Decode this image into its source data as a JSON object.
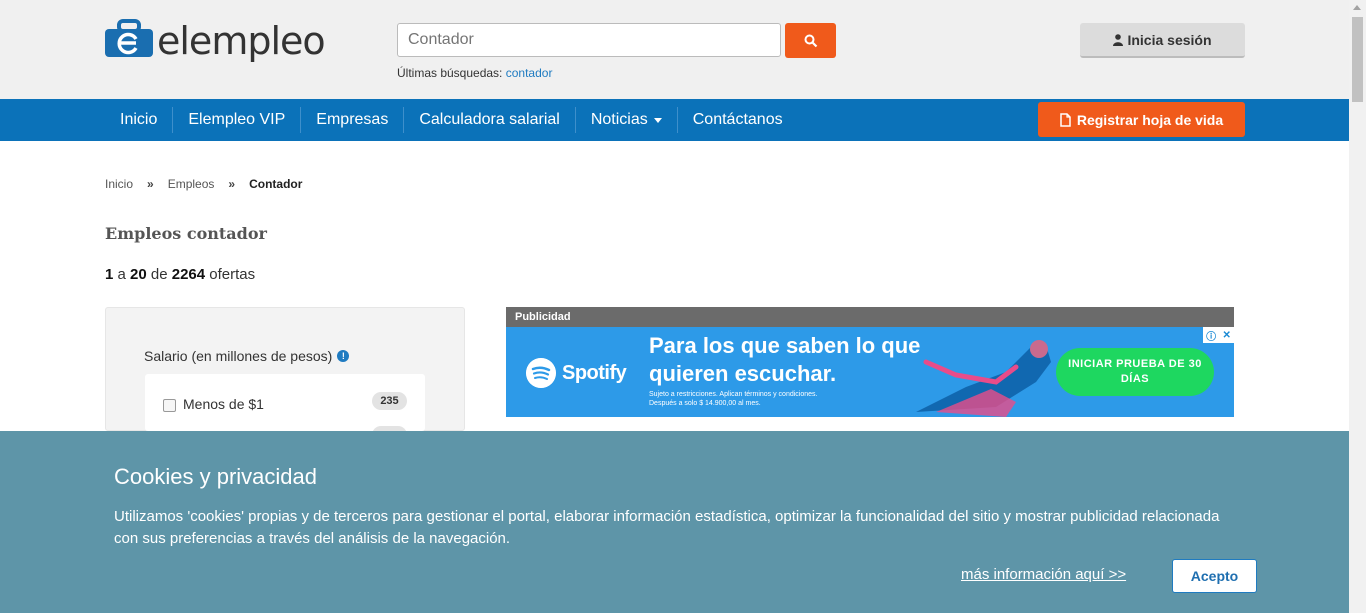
{
  "header": {
    "logo_text": "elempleo",
    "search_placeholder": "Contador",
    "recent_label": "Últimas búsquedas:",
    "recent_link": "contador",
    "login_label": "Inicia sesión"
  },
  "nav": {
    "items": [
      "Inicio",
      "Elempleo VIP",
      "Empresas",
      "Calculadora salarial",
      "Noticias",
      "Contáctanos"
    ],
    "register_label": "Registrar hoja de vida"
  },
  "breadcrumb": {
    "items": [
      "Inicio",
      "Empleos",
      "Contador"
    ],
    "separator": "»"
  },
  "main": {
    "title": "Empleos contador",
    "results": {
      "from": "1",
      "a": "a",
      "to": "20",
      "de": "de",
      "total": "2264",
      "suffix": "ofertas"
    }
  },
  "filters": {
    "salary_label": "Salario (en millones de pesos)",
    "options": [
      {
        "label": "Menos de $1",
        "count": "235"
      }
    ]
  },
  "ad": {
    "label": "Publicidad",
    "brand": "Spotify",
    "headline": "Para los que saben lo que quieren escuchar.",
    "fine_print_1": "Sujeto a restricciones. Aplican términos y condiciones.",
    "fine_print_2": "Después a solo $ 14.900,00 al mes.",
    "cta": "INICIAR PRUEBA DE 30 DÍAS"
  },
  "cookie": {
    "title": "Cookies y privacidad",
    "text": "Utilizamos 'cookies' propias y de terceros para gestionar el portal, elaborar información estadística, optimizar la funcionalidad del sitio y mostrar publicidad relacionada con sus preferencias a través del análisis de la navegación.",
    "more_link": "más información aquí >>",
    "accept_label": "Acepto"
  },
  "colors": {
    "brand_blue": "#0b72b9",
    "accent_orange": "#f05a1b",
    "cookie_bg": "#5e95a8",
    "spotify_green": "#1ed760"
  }
}
